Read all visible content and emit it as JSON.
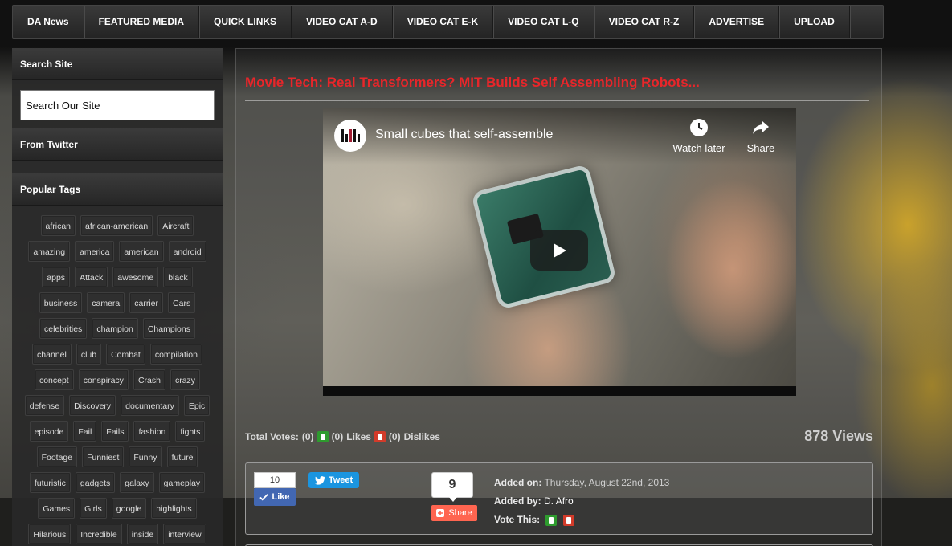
{
  "nav": {
    "items": [
      "DA News",
      "FEATURED MEDIA",
      "QUICK LINKS",
      "VIDEO CAT A-D",
      "VIDEO CAT E-K",
      "VIDEO CAT L-Q",
      "VIDEO CAT R-Z",
      "ADVERTISE",
      "UPLOAD"
    ]
  },
  "sidebar": {
    "search_heading": "Search Site",
    "search_value": "Search Our Site",
    "twitter_heading": "From Twitter",
    "tags_heading": "Popular Tags",
    "tags": [
      "african",
      "african-american",
      "Aircraft",
      "amazing",
      "america",
      "american",
      "android",
      "apps",
      "Attack",
      "awesome",
      "black",
      "business",
      "camera",
      "carrier",
      "Cars",
      "celebrities",
      "champion",
      "Champions",
      "channel",
      "club",
      "Combat",
      "compilation",
      "concept",
      "conspiracy",
      "Crash",
      "crazy",
      "defense",
      "Discovery",
      "documentary",
      "Epic",
      "episode",
      "Fail",
      "Fails",
      "fashion",
      "fights",
      "Footage",
      "Funniest",
      "Funny",
      "future",
      "futuristic",
      "gadgets",
      "galaxy",
      "gameplay",
      "Games",
      "Girls",
      "google",
      "highlights",
      "Hilarious",
      "Incredible",
      "inside",
      "interview"
    ]
  },
  "post": {
    "title": "Movie Tech: Real Transformers? MIT Builds Self Assembling Robots...",
    "video": {
      "title": "Small cubes that self-assemble",
      "watch_later": "Watch later",
      "share": "Share"
    },
    "votes": {
      "total_label": "Total Votes:",
      "total": "(0)",
      "likes_count": "(0)",
      "likes_label": "Likes",
      "dislikes_count": "(0)",
      "dislikes_label": "Dislikes"
    },
    "views": "878 Views",
    "social": {
      "fb_count": "10",
      "fb_like": "Like",
      "tweet": "Tweet",
      "share_count": "9",
      "share_label": "Share"
    },
    "meta": {
      "added_on_label": "Added on:",
      "added_on": "Thursday, August 22nd, 2013",
      "added_by_label": "Added by:",
      "added_by": "D. Afro",
      "vote_label": "Vote This:"
    }
  },
  "colors": {
    "title_red": "#e8262a",
    "like_green": "#2e9b2e",
    "dislike_red": "#d23b2a",
    "facebook_blue": "#4267b2",
    "twitter_blue": "#1b95e0",
    "share_orange": "#ff6550"
  }
}
